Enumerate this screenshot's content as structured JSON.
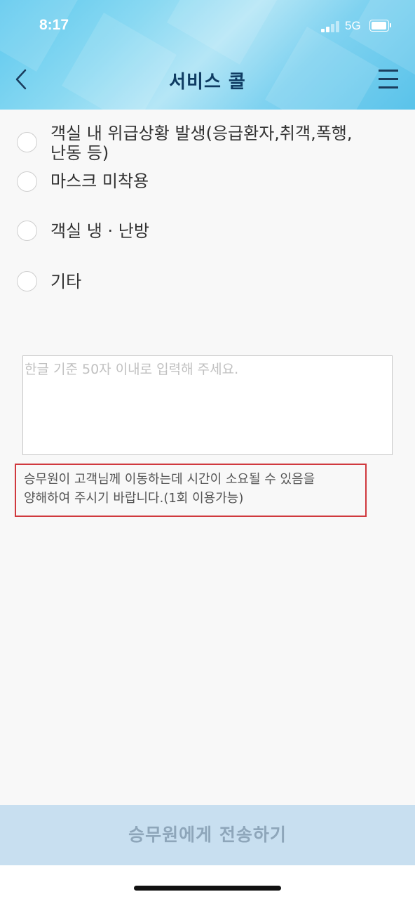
{
  "status_bar": {
    "time": "8:17",
    "network": "5G"
  },
  "nav": {
    "title": "서비스 콜",
    "back_icon": "chevron-left-icon",
    "menu_icon": "hamburger-menu-icon"
  },
  "options": [
    {
      "label": "객실 내 위급상황 발생(응급환자,취객,폭행,\n난동 등)",
      "selected": false
    },
    {
      "label": "마스크 미착용",
      "selected": false
    },
    {
      "label": "객실 냉 · 난방",
      "selected": false
    },
    {
      "label": "기타",
      "selected": false
    }
  ],
  "message_input": {
    "placeholder": "한글 기준 50자 이내로 입력해 주세요.",
    "value": ""
  },
  "notice": {
    "text": "승무원이 고객님께 이동하는데 시간이 소요될 수 있음을\n양해하여 주시기 바랍니다.(1회 이용가능)"
  },
  "submit": {
    "label": "승무원에게 전송하기"
  },
  "colors": {
    "title": "#0f3c63",
    "notice_border": "#d0393e",
    "submit_bg": "#c8dff0",
    "submit_text": "#8ea6ba"
  }
}
